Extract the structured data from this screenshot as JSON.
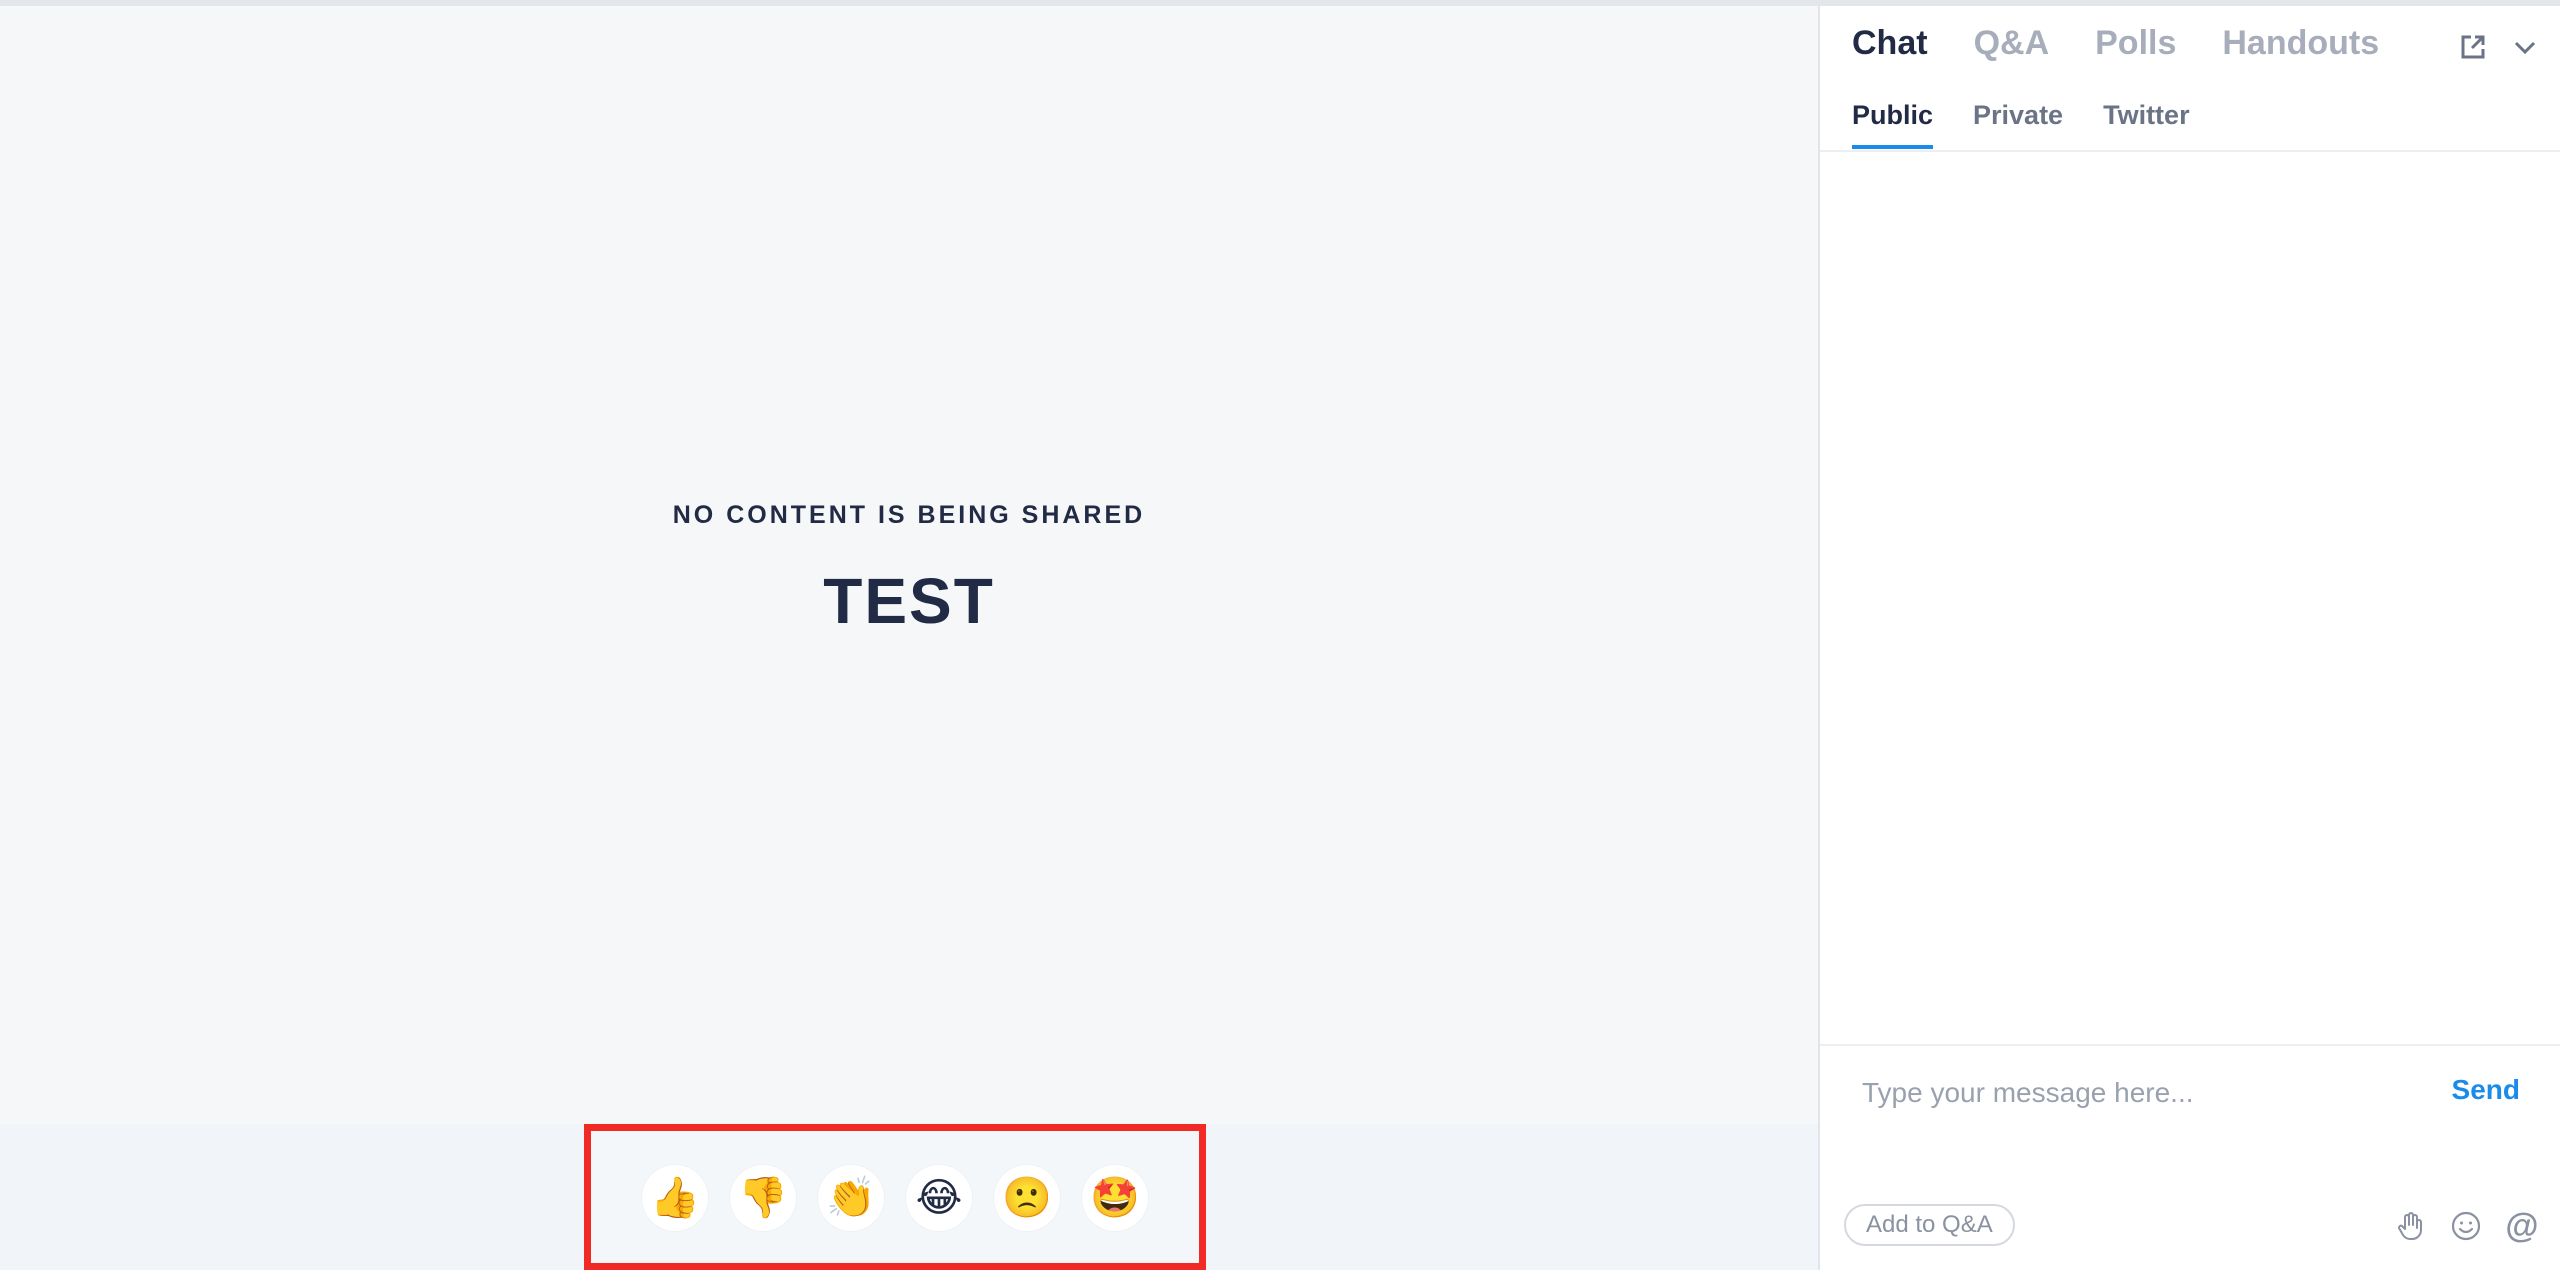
{
  "stage": {
    "status_text": "NO CONTENT IS BEING SHARED",
    "title": "TEST"
  },
  "reactions": [
    {
      "name": "thumbs-up",
      "emoji": "👍"
    },
    {
      "name": "thumbs-down",
      "emoji": "👎"
    },
    {
      "name": "clapping",
      "emoji": "👏"
    },
    {
      "name": "laughing",
      "emoji": "😂"
    },
    {
      "name": "confused",
      "emoji": "🙁"
    },
    {
      "name": "star-struck",
      "emoji": "🤩"
    }
  ],
  "panel": {
    "main_tabs": [
      "Chat",
      "Q&A",
      "Polls",
      "Handouts"
    ],
    "active_main_tab": "Chat",
    "sub_tabs": [
      "Public",
      "Private",
      "Twitter"
    ],
    "active_sub_tab": "Public",
    "actions": [
      "popout-icon",
      "chevron-down-icon"
    ]
  },
  "composer": {
    "placeholder": "Type your message here...",
    "send_label": "Send",
    "add_qa_label": "Add to Q&A",
    "tools": [
      "raise-hand-icon",
      "emoji-icon",
      "mention-icon"
    ],
    "mention_symbol": "@"
  },
  "colors": {
    "accent": "#1a8bea",
    "highlight": "#f22a26",
    "text": "#222b45",
    "muted": "#a7adbb"
  }
}
